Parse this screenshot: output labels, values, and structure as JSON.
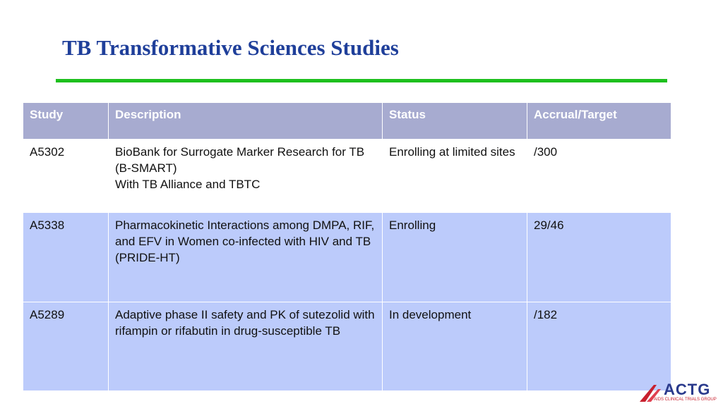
{
  "slide": {
    "title": "TB Transformative Sciences Studies",
    "accent_color": "#1ec01e",
    "title_color": "#1f3f9a"
  },
  "table": {
    "headers": [
      "Study",
      "Description",
      "Status",
      "Accrual/Target"
    ],
    "rows": [
      {
        "study": "A5302",
        "description": [
          "BioBank for Surrogate Marker Research for TB (B-SMART)",
          "With TB Alliance and TBTC"
        ],
        "status": "Enrolling at limited sites",
        "accrual": "/300"
      },
      {
        "study": "A5338",
        "description": [
          "Pharmacokinetic Interactions among DMPA, RIF, and EFV in Women co-infected with HIV and TB   (PRIDE-HT)"
        ],
        "status": "Enrolling",
        "accrual": "29/46"
      },
      {
        "study": "A5289",
        "description": [
          "Adaptive phase II safety and PK of sutezolid with rifampin or rifabutin in drug-susceptible TB"
        ],
        "status": "In development",
        "accrual": "/182"
      }
    ]
  },
  "logo": {
    "text": "ACTG",
    "subtext": "AIDS CLINICAL TRIALS GROUP",
    "icon": "actg-logo-icon"
  }
}
